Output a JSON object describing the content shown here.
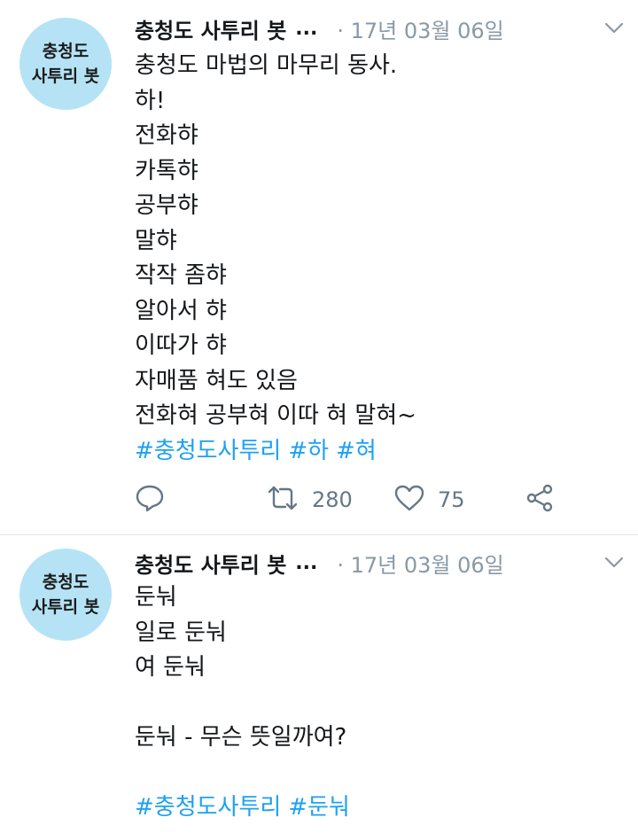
{
  "tweets": [
    {
      "avatar_lines": [
        "충청도",
        "사투리 봇"
      ],
      "name": "충청도 사투리 봇",
      "name_ellipsis": "...",
      "date": "· 17년 03월 06일",
      "lines": [
        "충청도 마법의 마무리 동사.",
        "하!",
        "전화햐",
        "카톡햐",
        "공부햐",
        "말햐",
        "작작 좀햐",
        "알아서 햐",
        "이따가 햐",
        "자매품 혀도 있음",
        "전화혀 공부혀 이따 혀 말혀~"
      ],
      "hashtags": [
        "#충청도사투리",
        "#하",
        "#혀"
      ],
      "retweets": "280",
      "likes": "75"
    },
    {
      "avatar_lines": [
        "충청도",
        "사투리 봇"
      ],
      "name": "충청도 사투리 봇",
      "name_ellipsis": "...",
      "date": "· 17년 03월 06일",
      "lines": [
        "둔눠",
        "일로 둔눠",
        "여 둔눠",
        "",
        "둔눠 - 무슨 뜻일까여?",
        ""
      ],
      "hashtags": [
        "#충청도사투리",
        "#둔눠"
      ]
    }
  ],
  "colors": {
    "link": "#1da1f2",
    "muted": "#8899a6",
    "avatar_bg": "#b5e3f5",
    "icon": "#657786"
  },
  "icons": {
    "reply": "reply-icon",
    "retweet": "retweet-icon",
    "like": "heart-icon",
    "share": "share-icon",
    "menu": "chevron-down-icon"
  }
}
